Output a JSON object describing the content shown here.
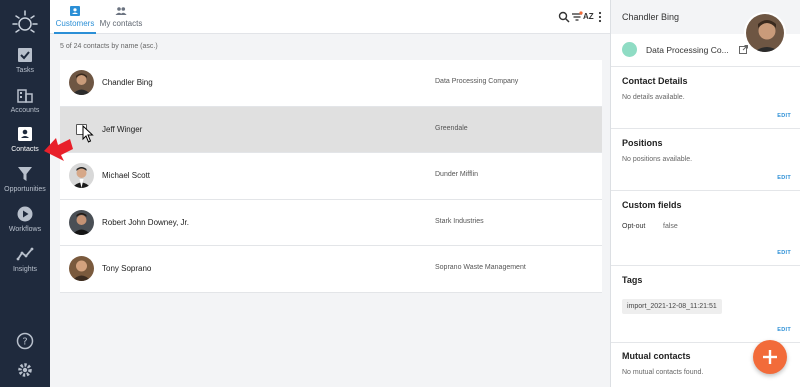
{
  "sidebar": {
    "logo_icon": "sun-logo-icon",
    "items": [
      {
        "label": "Tasks",
        "icon": "checkbox-icon"
      },
      {
        "label": "Accounts",
        "icon": "building-icon"
      },
      {
        "label": "Contacts",
        "icon": "contact-card-icon"
      },
      {
        "label": "Opportunities",
        "icon": "funnel-icon"
      },
      {
        "label": "Workflows",
        "icon": "play-circle-icon"
      },
      {
        "label": "Insights",
        "icon": "trend-line-icon"
      }
    ],
    "bottom": [
      {
        "icon": "help-icon"
      },
      {
        "icon": "gear-icon"
      }
    ],
    "active_color": "#ffffff",
    "background": "#1f2a3d"
  },
  "tabs": [
    {
      "label": "Customers",
      "icon": "contact-card-icon"
    },
    {
      "label": "My contacts",
      "icon": "people-icon"
    }
  ],
  "toolbar": {
    "sort_label": "AZ"
  },
  "list": {
    "count_text": "5 of 24 contacts by name (asc.)",
    "rows": [
      {
        "name": "Chandler Bing",
        "company": "Data Processing Company"
      },
      {
        "name": "Jeff Winger",
        "company": "Greendale"
      },
      {
        "name": "Michael Scott",
        "company": "Dunder Mifflin"
      },
      {
        "name": "Robert John Downey, Jr.",
        "company": "Stark Industries"
      },
      {
        "name": "Tony Soprano",
        "company": "Soprano Waste Management"
      }
    ]
  },
  "detail": {
    "name": "Chandler Bing",
    "company": "Data Processing Co...",
    "contact_details": {
      "title": "Contact Details",
      "text": "No details available.",
      "edit": "EDIT"
    },
    "positions": {
      "title": "Positions",
      "text": "No positions available.",
      "edit": "EDIT"
    },
    "custom_fields": {
      "title": "Custom fields",
      "field_label": "Opt-out",
      "field_value": "false",
      "edit": "EDIT"
    },
    "tags": {
      "title": "Tags",
      "tag": "import_2021-12-08_11:21:51",
      "edit": "EDIT"
    },
    "mutual": {
      "title": "Mutual contacts",
      "text": "No mutual contacts found."
    }
  },
  "colors": {
    "accent": "#2b8fd6",
    "fab": "#f26b3a",
    "pointer": "#e8202a"
  }
}
